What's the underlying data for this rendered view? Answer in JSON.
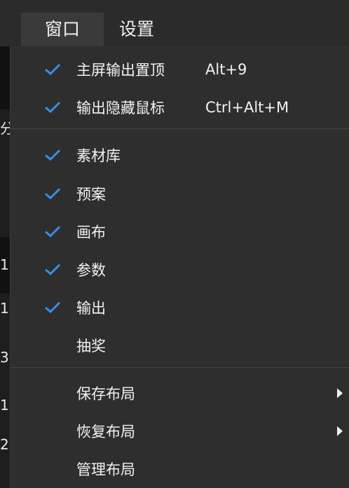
{
  "menubar": {
    "window_label": "窗口",
    "settings_label": "设置"
  },
  "left_strip": {
    "rows": [
      "分",
      "1",
      "1",
      "3",
      "1",
      "2"
    ]
  },
  "dropdown": {
    "check_color": "#3a8ee6",
    "group1": [
      {
        "label": "主屏输出置顶",
        "shortcut": "Alt+9",
        "checked": true
      },
      {
        "label": "输出隐藏鼠标",
        "shortcut": "Ctrl+Alt+M",
        "checked": true
      }
    ],
    "group2": [
      {
        "label": "素材库",
        "checked": true
      },
      {
        "label": "预案",
        "checked": true
      },
      {
        "label": "画布",
        "checked": true
      },
      {
        "label": "参数",
        "checked": true
      },
      {
        "label": "输出",
        "checked": true
      },
      {
        "label": "抽奖",
        "checked": false
      }
    ],
    "group3": [
      {
        "label": "保存布局",
        "has_submenu": true
      },
      {
        "label": "恢复布局",
        "has_submenu": true
      },
      {
        "label": "管理布局",
        "has_submenu": false
      }
    ]
  }
}
